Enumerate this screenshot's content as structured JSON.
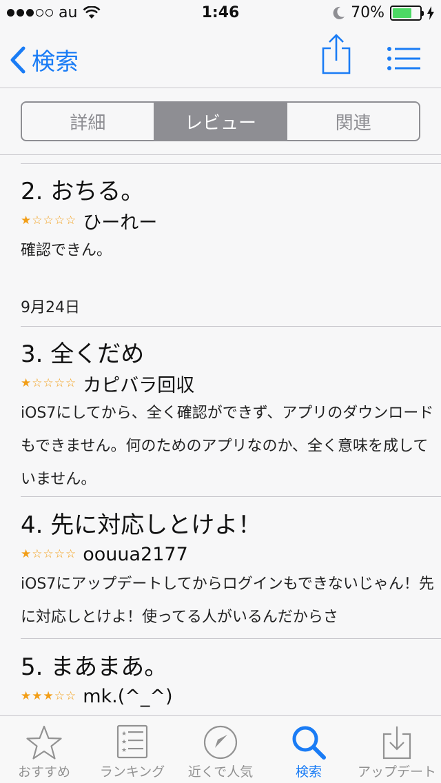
{
  "status": {
    "carrier": "au",
    "time": "1:46",
    "battery": "70%",
    "battery_level": 0.7
  },
  "nav": {
    "back_label": "検索"
  },
  "segments": [
    {
      "label": "詳細",
      "active": false
    },
    {
      "label": "レビュー",
      "active": true
    },
    {
      "label": "関連",
      "active": false
    }
  ],
  "reviews": [
    {
      "title": "2. おちる。",
      "rating": 1,
      "author": "ひーれー",
      "body": "確認できん。",
      "date": "9月24日"
    },
    {
      "title": "3. 全くだめ",
      "rating": 1,
      "author": "カピバラ回収",
      "body": "iOS7にしてから、全く確認ができず、アプリのダウンロードもできません。何のためのアプリなのか、全く意味を成していません。",
      "date": ""
    },
    {
      "title": "4. 先に対応しとけよ！",
      "rating": 1,
      "author": "oouua2177",
      "body": "iOS7にアップデートしてからログインもできないじゃん！先に対応しとけよ！使ってる人がいるんだからさ",
      "date": ""
    },
    {
      "title": "5. まあまあ。",
      "rating": 3,
      "author": "mk.(^_^)",
      "body": "",
      "date": ""
    }
  ],
  "tabs": [
    {
      "label": "おすすめ",
      "icon": "star-icon",
      "active": false
    },
    {
      "label": "ランキング",
      "icon": "ranking-list-icon",
      "active": false
    },
    {
      "label": "近くで人気",
      "icon": "compass-icon",
      "active": false
    },
    {
      "label": "検索",
      "icon": "search-icon",
      "active": true
    },
    {
      "label": "アップデート",
      "icon": "update-download-icon",
      "active": false
    }
  ],
  "colors": {
    "accent": "#1a7cf5",
    "star": "#f29e17",
    "segment": "#8e8e93",
    "battery": "#4cd964"
  }
}
